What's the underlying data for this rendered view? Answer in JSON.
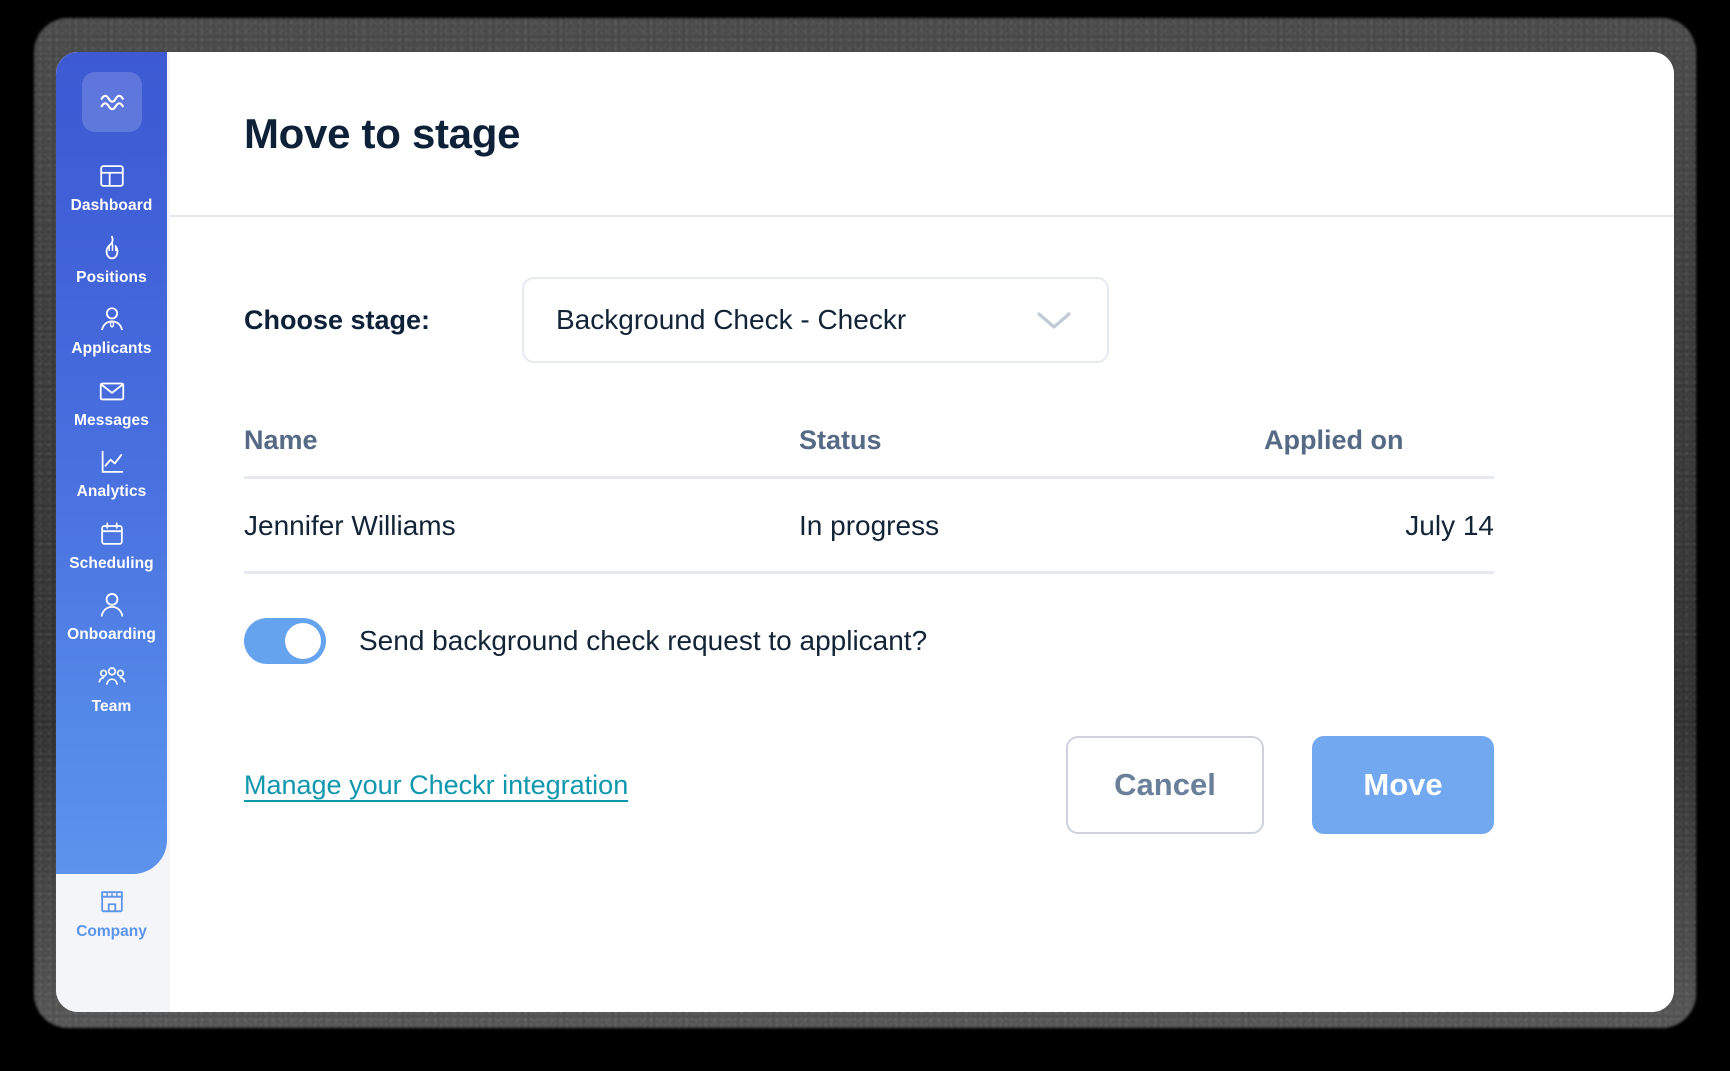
{
  "sidebar": {
    "logo_icon": "wave-logo-icon",
    "items": [
      {
        "label": "Dashboard",
        "icon": "dashboard-icon"
      },
      {
        "label": "Positions",
        "icon": "flame-icon"
      },
      {
        "label": "Applicants",
        "icon": "person-badge-icon"
      },
      {
        "label": "Messages",
        "icon": "envelope-icon"
      },
      {
        "label": "Analytics",
        "icon": "line-chart-icon"
      },
      {
        "label": "Scheduling",
        "icon": "calendar-icon"
      },
      {
        "label": "Team",
        "icon": "people-group-icon"
      }
    ],
    "company": {
      "label": "Company",
      "icon": "storefront-icon"
    },
    "accent_top": "#3d5ad4",
    "accent_bottom": "#5c93ec"
  },
  "modal": {
    "title": "Move to stage",
    "stage_label": "Choose stage:",
    "stage_selected": "Background Check - Checkr",
    "stage_chevron_icon": "chevron-down-icon",
    "table": {
      "headers": [
        "Name",
        "Status",
        "Applied on"
      ],
      "rows": [
        {
          "name": "Jennifer Williams",
          "status": "In progress",
          "applied_on": "July 14"
        }
      ]
    },
    "toggle": {
      "label": "Send background check request to applicant?",
      "state": "on",
      "on_color": "#66a3ef"
    },
    "manage_link": "Manage your Checkr integration",
    "link_color": "#0f97ad",
    "cancel_label": "Cancel",
    "move_label": "Move",
    "move_color": "#71a8ef"
  }
}
